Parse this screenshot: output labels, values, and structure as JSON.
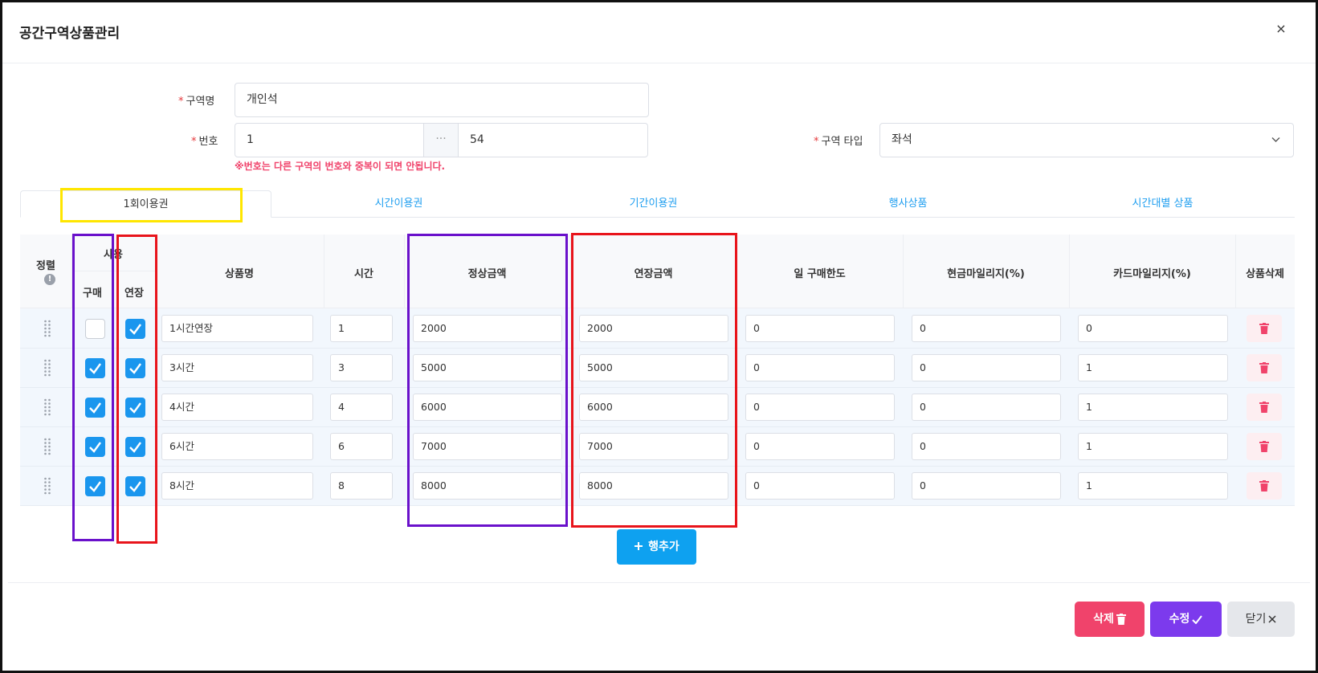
{
  "modal": {
    "title": "공간구역상품관리",
    "close_icon": "×"
  },
  "form": {
    "zone_name_label": "구역명",
    "zone_name_value": "개인석",
    "number_label": "번호",
    "number_from": "1",
    "number_sep": "···",
    "number_to": "54",
    "number_hint": "※번호는 다른 구역의 번호와 중복이 되면 안됩니다.",
    "zone_type_label": "구역 타입",
    "zone_type_value": "좌석",
    "required_mark": "*"
  },
  "tabs": [
    {
      "label": "1회이용권",
      "active": true
    },
    {
      "label": "시간이용권",
      "active": false
    },
    {
      "label": "기간이용권",
      "active": false
    },
    {
      "label": "행사상품",
      "active": false
    },
    {
      "label": "시간대별 상품",
      "active": false
    }
  ],
  "table": {
    "headers": {
      "sort": "정렬",
      "use": "사용",
      "buy": "구매",
      "extend": "연장",
      "name": "상품명",
      "time": "시간",
      "regular_price": "정상금액",
      "extend_price": "연장금액",
      "daily_limit": "일 구매한도",
      "cash_mileage": "현금마일리지(%)",
      "card_mileage": "카드마일리지(%)",
      "delete": "상품삭제"
    },
    "rows": [
      {
        "buy": false,
        "extend": true,
        "name": "1시간연장",
        "time": "1",
        "regular_price": "2000",
        "extend_price": "2000",
        "daily_limit": "0",
        "cash_mileage": "0",
        "card_mileage": "0"
      },
      {
        "buy": true,
        "extend": true,
        "name": "3시간",
        "time": "3",
        "regular_price": "5000",
        "extend_price": "5000",
        "daily_limit": "0",
        "cash_mileage": "0",
        "card_mileage": "1"
      },
      {
        "buy": true,
        "extend": true,
        "name": "4시간",
        "time": "4",
        "regular_price": "6000",
        "extend_price": "6000",
        "daily_limit": "0",
        "cash_mileage": "0",
        "card_mileage": "1"
      },
      {
        "buy": true,
        "extend": true,
        "name": "6시간",
        "time": "6",
        "regular_price": "7000",
        "extend_price": "7000",
        "daily_limit": "0",
        "cash_mileage": "0",
        "card_mileage": "1"
      },
      {
        "buy": true,
        "extend": true,
        "name": "8시간",
        "time": "8",
        "regular_price": "8000",
        "extend_price": "8000",
        "daily_limit": "0",
        "cash_mileage": "0",
        "card_mileage": "1"
      }
    ]
  },
  "add_row": {
    "label": "행추가",
    "icon": "plus-icon"
  },
  "footer": {
    "delete_label": "삭제",
    "edit_label": "수정",
    "close_label": "닫기"
  },
  "colors": {
    "accent": "#1e9ef0",
    "checkbox": "#1a96ee",
    "danger": "#f0436b",
    "edit": "#7c3aed",
    "annotation_yellow": "#ffe600",
    "annotation_purple": "#6a11cb",
    "annotation_red": "#e8141b"
  }
}
